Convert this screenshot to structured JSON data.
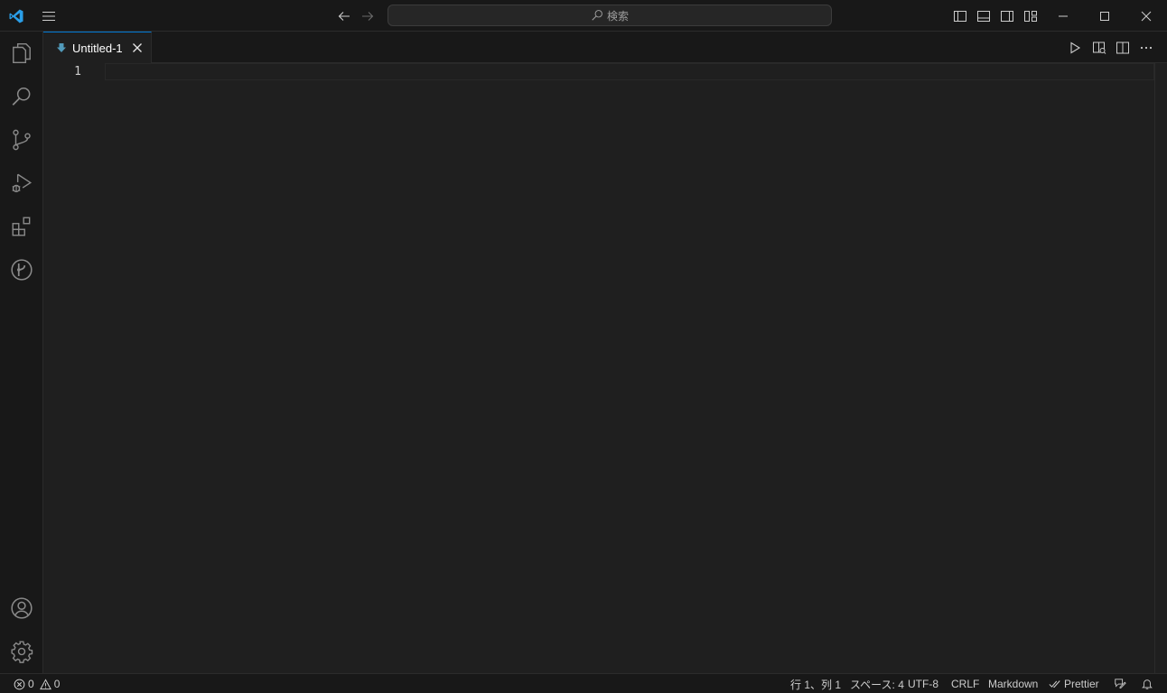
{
  "titlebar": {
    "search_placeholder": "検索"
  },
  "tab": {
    "label": "Untitled-1"
  },
  "editor": {
    "line_number": "1"
  },
  "statusbar": {
    "errors": "0",
    "warnings": "0",
    "position": "行 1、列 1",
    "indent": "スペース: 4",
    "encoding": "UTF-8",
    "eol": "CRLF",
    "language": "Markdown",
    "formatter": "Prettier"
  },
  "colors": {
    "accent": "#0078d4",
    "background": "#1f1f1f",
    "chrome": "#181818"
  }
}
